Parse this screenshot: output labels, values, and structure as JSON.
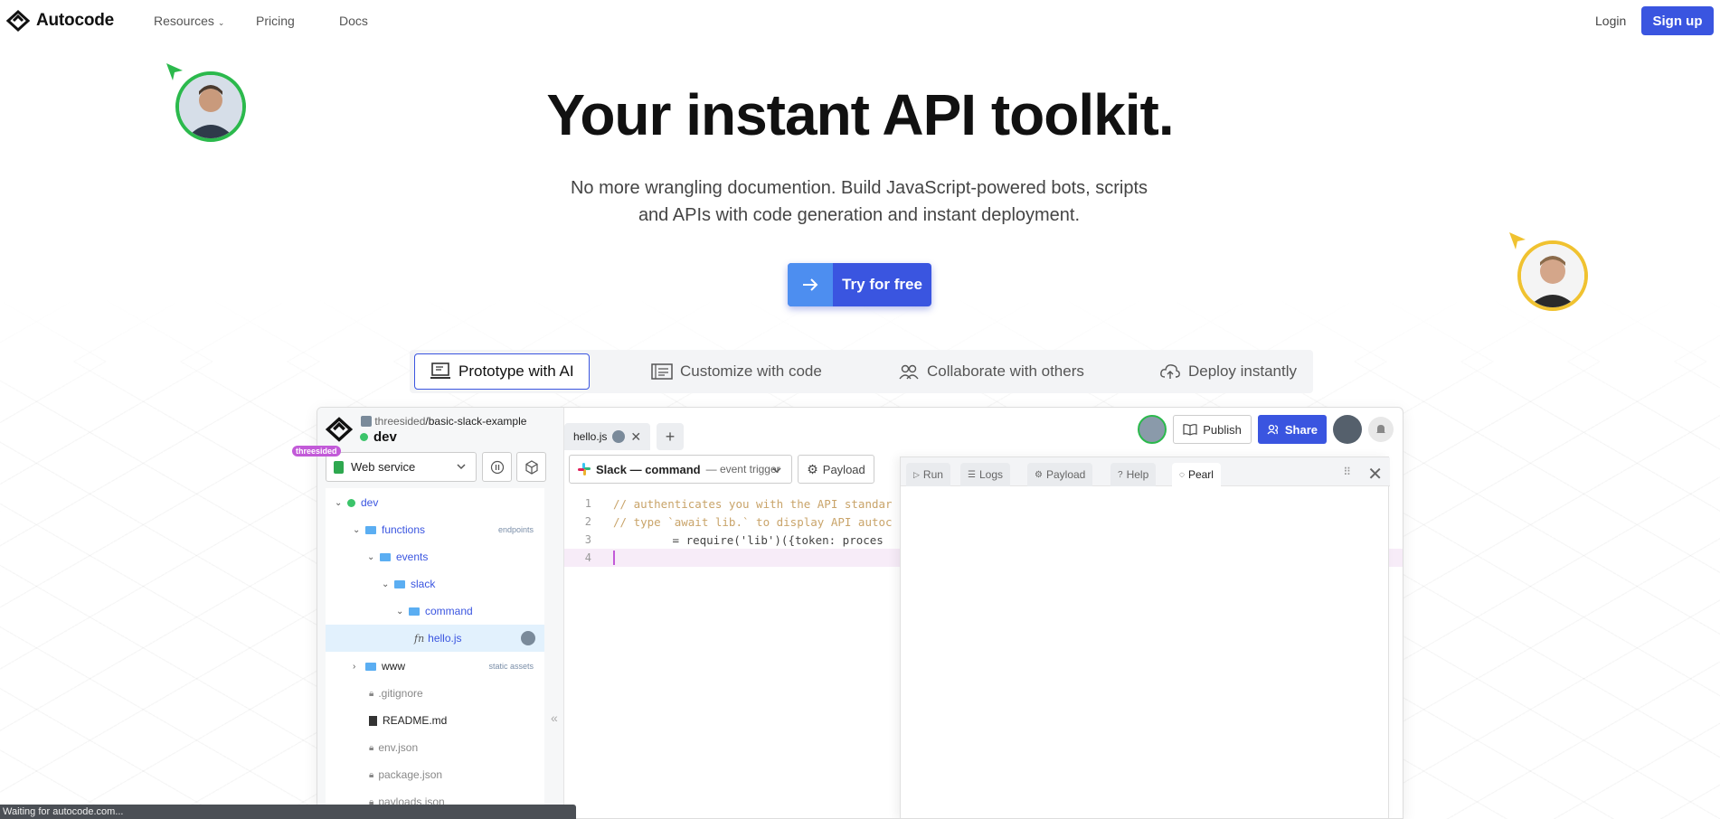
{
  "nav": {
    "brand": "Autocode",
    "links": [
      "Resources",
      "Pricing",
      "Docs"
    ],
    "login": "Login",
    "signup": "Sign up"
  },
  "hero": {
    "title": "Your instant API toolkit.",
    "subtitle_line1": "No more wrangling documention. Build JavaScript-powered bots, scripts",
    "subtitle_line2": "and APIs with code generation and instant deployment.",
    "cta": "Try for free"
  },
  "feature_tabs": [
    "Prototype with AI",
    "Customize with code",
    "Collaborate with others",
    "Deploy instantly"
  ],
  "ide": {
    "owner": "threesided",
    "project": "/basic-slack-example",
    "env": "dev",
    "service": "Web service",
    "tree": [
      {
        "label": "dev",
        "tag": ""
      },
      {
        "label": "functions",
        "tag": "endpoints"
      },
      {
        "label": "events",
        "tag": ""
      },
      {
        "label": "slack",
        "tag": ""
      },
      {
        "label": "command",
        "tag": ""
      },
      {
        "label": "hello.js",
        "tag": ""
      },
      {
        "label": "www",
        "tag": "static assets"
      },
      {
        "label": ".gitignore",
        "tag": ""
      },
      {
        "label": "README.md",
        "tag": ""
      },
      {
        "label": "env.json",
        "tag": ""
      },
      {
        "label": "package.json",
        "tag": ""
      },
      {
        "label": "payloads.json",
        "tag": ""
      }
    ],
    "fn_prefix": "fn",
    "file_tab": "hello.js",
    "publish": "Publish",
    "share": "Share",
    "trigger_main": "Slack — command",
    "trigger_sub": "— event trigger",
    "payload": "Payload",
    "code_lines": [
      "// authenticates you with the API standar",
      "// type `await lib.` to display API autoc",
      " = require('lib')({token: proces",
      ""
    ],
    "line_numbers": [
      "1",
      "2",
      "3",
      "4"
    ],
    "cursor_user": "threesided",
    "panel_tabs": [
      "Run",
      "Logs",
      "Payload",
      "Help",
      "Pearl"
    ]
  },
  "status_bar": "Waiting for autocode.com...",
  "colors": {
    "brand_blue": "#3a55e0",
    "folder": "#5baef2",
    "online": "#3bc46a",
    "cursor_tag": "#c25ad8"
  }
}
